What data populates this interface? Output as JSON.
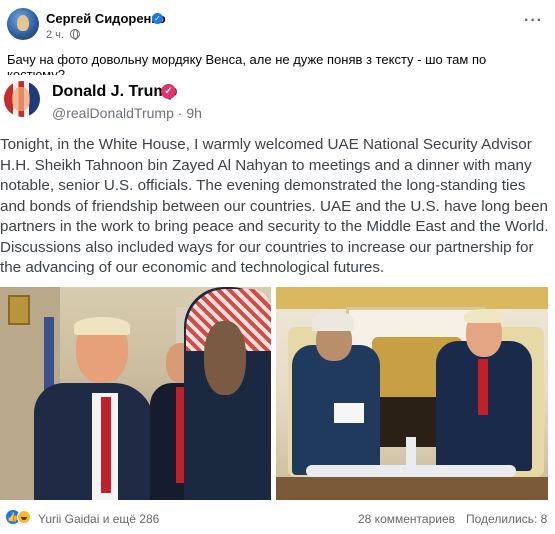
{
  "post": {
    "author": "Сергей Сидоренко",
    "time": "2 ч.",
    "more_label": "···",
    "caption": "Бачу на фото довольну мордяку Венса, але не дуже поняв з тексту - шо там по костюму?"
  },
  "embed": {
    "name": "Donald J. Trump",
    "handle": "@realDonaldTrump",
    "separator": "·",
    "age": "9h",
    "text": "Tonight, in the White House, I warmly welcomed UAE National Security Advisor H.H. Sheikh Tahnoon bin Zayed Al Nahyan to meetings and a dinner with many notable, senior U.S. officials. The evening demonstrated the long-standing ties and bonds of friendship between our countries. UAE and the U.S. have long been partners in the work to bring peace and security to the Middle East and the World. Discussions also included ways for our countries to increase our partnership for the advancing of our economic and technological futures."
  },
  "footer": {
    "reactions_text": "Yurii Gaidai и ещё 286",
    "comments_text": "28 комментариев",
    "shares_text": "Поделились: 8"
  },
  "colors": {
    "facebook_blue": "#1877f2",
    "truth_badge": "#e5306c",
    "muted_text": "#65676b"
  },
  "icons": [
    "globe-icon",
    "verified-icon",
    "more-icon",
    "like-icon",
    "haha-icon"
  ]
}
